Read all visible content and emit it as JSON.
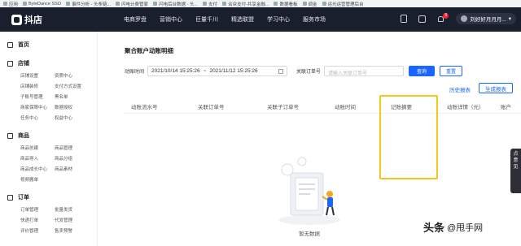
{
  "bookmarks": [
    {
      "label": "应用"
    },
    {
      "label": "ByteDance SSO"
    },
    {
      "label": "事件分析 - 头条链..."
    },
    {
      "label": "闪电计费管家"
    },
    {
      "label": "闪电后台数据 - 头..."
    },
    {
      "label": "支付"
    },
    {
      "label": "合众支付-共享金融..."
    },
    {
      "label": "数据看板"
    },
    {
      "label": "调金"
    },
    {
      "label": "运光运营管理后台"
    }
  ],
  "topnav": {
    "logo": "抖店",
    "menu": [
      "电商罗盘",
      "营销中心",
      "巨量千川",
      "精选联盟",
      "学习中心",
      "服务市场"
    ],
    "badge": "9",
    "user": "刘好好月月月..."
  },
  "sidebar": {
    "home": "首页",
    "sections": [
      {
        "title": "店铺",
        "items": [
          "店铺设置",
          "资质中心",
          "店铺装修",
          "支付方式设置",
          "子账号管理",
          "黑名单",
          "商家保障中心",
          "数据授权",
          "任务中心",
          "权益中心"
        ]
      },
      {
        "title": "商品",
        "items": [
          "商品创建",
          "商品管理",
          "商品导入",
          "商品分组",
          "商品成长中心",
          "商品素材",
          "视频搬单"
        ]
      },
      {
        "title": "订单",
        "items": [
          "订单管理",
          "批量发货",
          "快递打单",
          "代发管理",
          "评价管理",
          "售卖预警"
        ]
      }
    ]
  },
  "main": {
    "title": "聚合账户动账明细",
    "date_label": "动账时间",
    "date_start": "2021/10/14 15:25:26",
    "date_sep": "~",
    "date_end": "2021/11/12 15:25:26",
    "order_label": "关联订单号",
    "order_placeholder": "请输入关联订单号",
    "query": "查询",
    "reset": "重置",
    "history": "历史报表",
    "generate": "生成报表",
    "columns": [
      "动账流水号",
      "关联订单号",
      "关联子订单号",
      "动账时间",
      "记账摘要",
      "动账详情（元）",
      "账户"
    ],
    "empty": "暂无数据"
  },
  "float_tab": [
    "点",
    "意",
    "见"
  ],
  "watermark": {
    "prefix": "头条",
    "text": "@甩手网"
  },
  "colors": {
    "primary": "#1966ff",
    "highlight": "#f5c518",
    "topnav": "#1a1f2e"
  }
}
